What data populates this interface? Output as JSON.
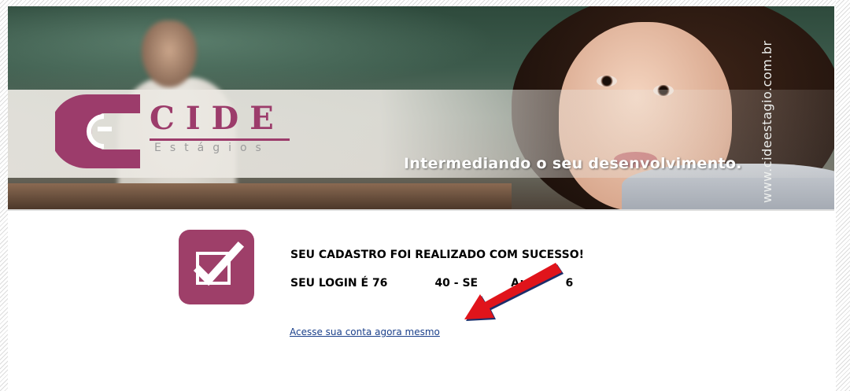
{
  "banner": {
    "logo_word": "CIDE",
    "logo_sub": "Estágios",
    "tagline": "Intermediando o seu desenvolvimento.",
    "vertical_url": "www.cideestagio.com.br"
  },
  "message": {
    "line1": "SEU CADASTRO FOI REALIZADO COM SUCESSO!",
    "line2_part1": "SEU LOGIN É 76",
    "line2_part2": "40 - SE",
    "line2_part3": "A: 1",
    "line2_part4": "6",
    "link": "Acesse sua conta agora mesmo"
  },
  "colors": {
    "brand": "#9c3c6b",
    "checkbox_bg": "#9e3f69",
    "link": "#1a3f8a",
    "arrow": "#e0141b"
  },
  "icons": {
    "check": "check-box-icon",
    "arrow": "red-arrow-annotation"
  }
}
